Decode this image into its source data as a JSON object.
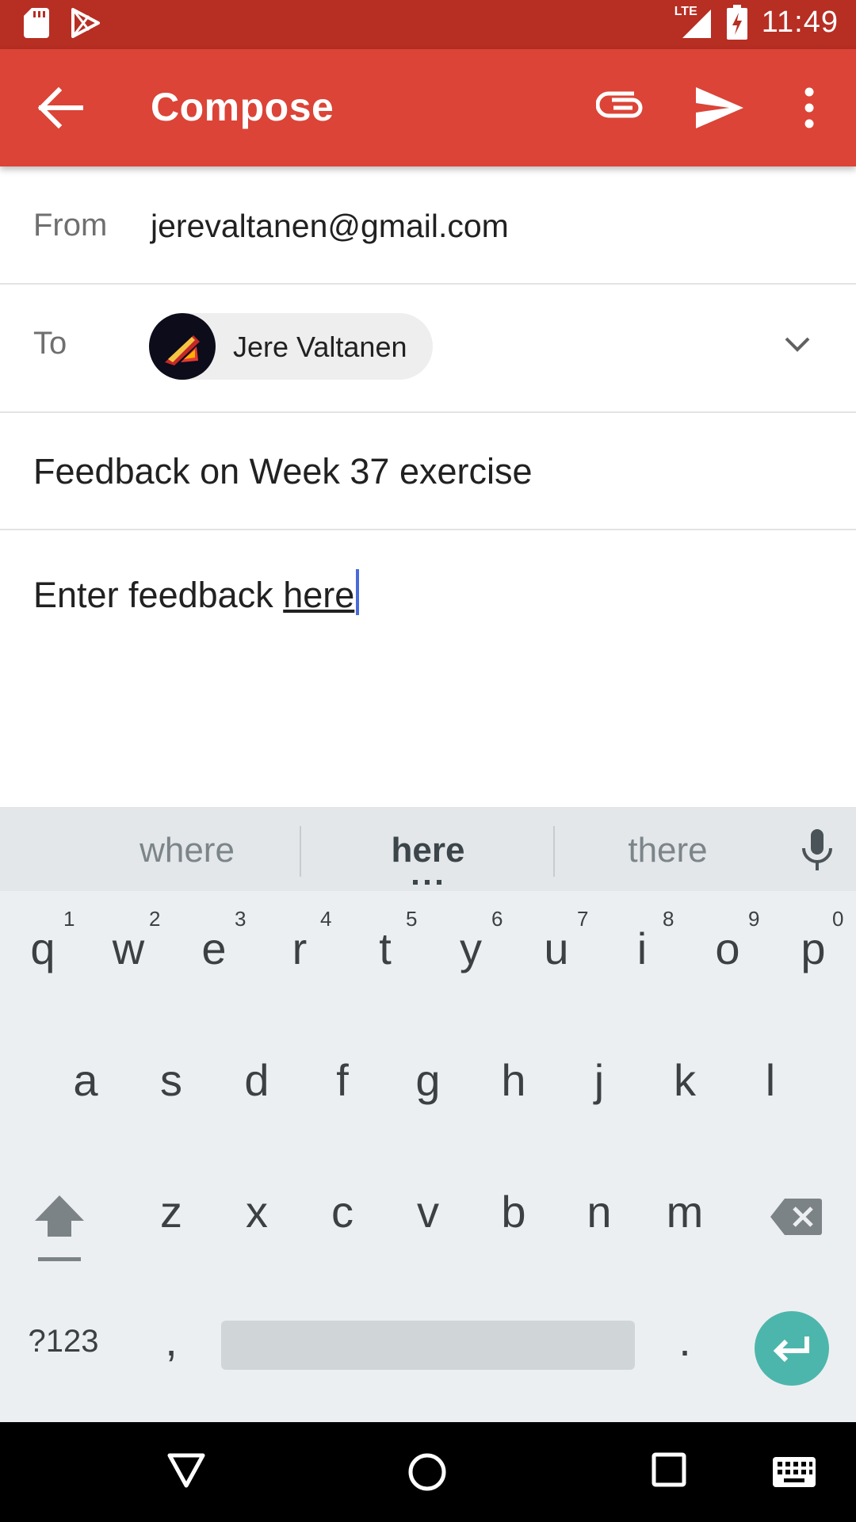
{
  "status_bar": {
    "time": "11:49",
    "network_label": "LTE",
    "icons": [
      "sd-card-icon",
      "play-store-icon",
      "signal-icon",
      "battery-charging-icon"
    ]
  },
  "app_bar": {
    "title": "Compose",
    "actions": [
      "back-arrow-icon",
      "attach-icon",
      "send-icon",
      "more-vert-icon"
    ],
    "color": "#db4437"
  },
  "compose": {
    "from_label": "From",
    "from_value": "jerevaltanen@gmail.com",
    "to_label": "To",
    "recipients": [
      {
        "name": "Jere Valtanen"
      }
    ],
    "subject": "Feedback on Week 37 exercise",
    "body_prefix": "Enter feedback ",
    "body_underlined": "here"
  },
  "keyboard": {
    "suggestions": [
      "where",
      "here",
      "there"
    ],
    "rows": [
      [
        "q",
        "w",
        "e",
        "r",
        "t",
        "y",
        "u",
        "i",
        "o",
        "p"
      ],
      [
        "a",
        "s",
        "d",
        "f",
        "g",
        "h",
        "j",
        "k",
        "l"
      ],
      [
        "z",
        "x",
        "c",
        "v",
        "b",
        "n",
        "m"
      ]
    ],
    "number_hints": [
      "1",
      "2",
      "3",
      "4",
      "5",
      "6",
      "7",
      "8",
      "9",
      "0"
    ],
    "symbols_key": "?123",
    "comma_key": ",",
    "period_key": ".",
    "accent_color": "#4db6ac"
  },
  "nav_bar": {
    "buttons": [
      "back-triangle-icon",
      "home-circle-icon",
      "recents-square-icon",
      "keyboard-switch-icon"
    ]
  }
}
